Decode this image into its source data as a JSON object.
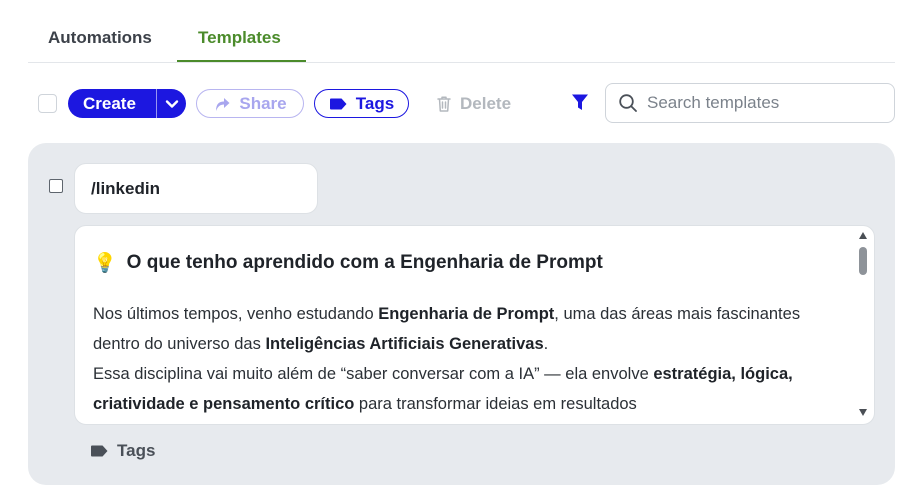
{
  "tabs": {
    "automations": "Automations",
    "templates": "Templates",
    "active": "templates"
  },
  "toolbar": {
    "create_label": "Create",
    "share_label": "Share",
    "tags_label": "Tags",
    "delete_label": "Delete",
    "search_placeholder": "Search templates",
    "icons": {
      "caret": "chevron-down-icon",
      "share": "share-arrow-icon",
      "tags": "tag-icon",
      "delete": "trash-icon",
      "filter": "filter-icon",
      "search": "search-icon"
    }
  },
  "template": {
    "shortcut": "/linkedin",
    "heading_emoji": "💡",
    "heading": "O que tenho aprendido com a Engenharia de Prompt",
    "body": [
      [
        {
          "t": "Nos últimos tempos, venho estudando ",
          "b": false
        },
        {
          "t": "Engenharia de Prompt",
          "b": true
        },
        {
          "t": ", uma das áreas mais fascinantes dentro do universo das ",
          "b": false
        },
        {
          "t": "Inteligências Artificiais Generativas",
          "b": true
        },
        {
          "t": ".",
          "b": false
        }
      ],
      [
        {
          "t": "Essa disciplina vai muito além de “saber conversar com a IA” — ela envolve ",
          "b": false
        },
        {
          "t": "estratégia, lógica, criatividade e pensamento crítico",
          "b": true
        },
        {
          "t": " para transformar ideias em resultados",
          "b": false
        }
      ]
    ],
    "tags_label": "Tags"
  },
  "colors": {
    "primary": "#1c17e0",
    "active_tab": "#4b8b2b",
    "card_bg": "#e7eaee"
  }
}
